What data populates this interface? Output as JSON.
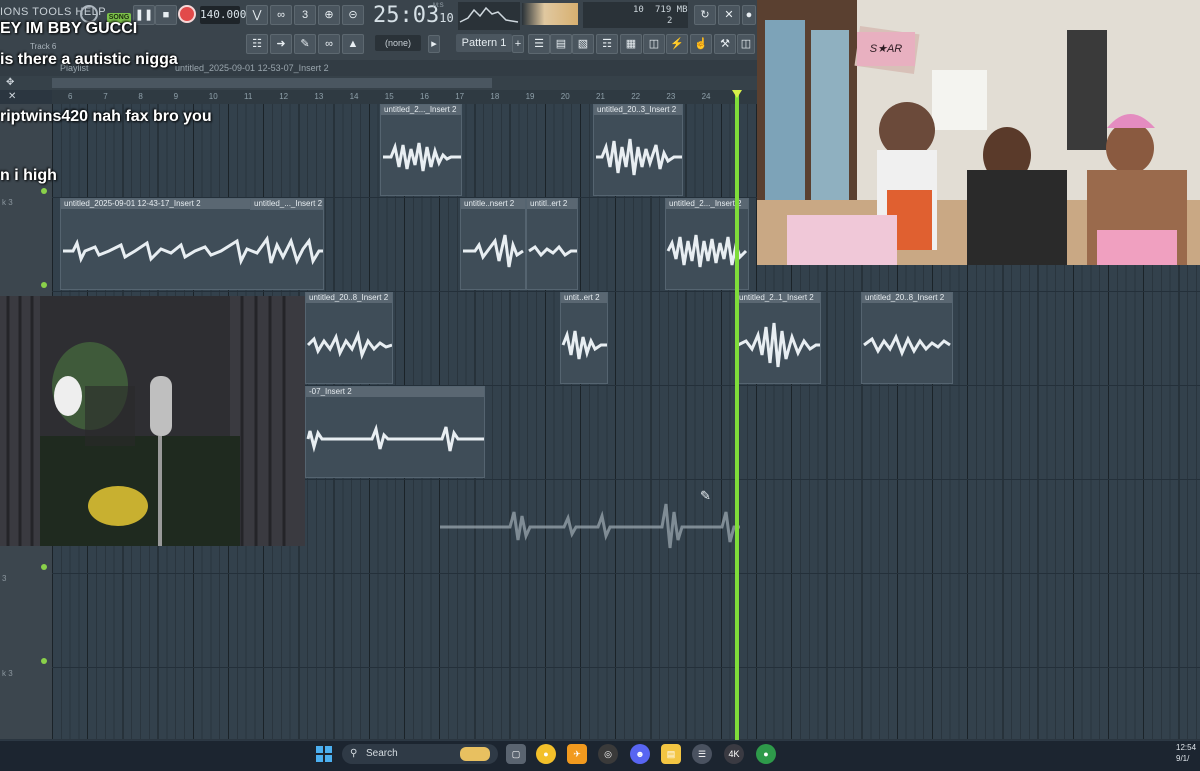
{
  "app": {
    "menu": "IONS TOOLS HELP",
    "song_badge": "SONG",
    "bpm": "140.000",
    "time_main": "25:03",
    "time_sub": "10",
    "time_unit": "M:S",
    "memory": "719 MB",
    "memory_top": "10",
    "memory_bottom": "2",
    "snap": "(none)",
    "pattern": "Pattern 1",
    "track_label": "Track 6"
  },
  "playlist": {
    "title": "Playlist",
    "breadcrumb": "untitled_2025-09-01 12-53-07_Insert 2",
    "ruler": [
      "6",
      "7",
      "8",
      "9",
      "10",
      "11",
      "12",
      "13",
      "14",
      "15",
      "16",
      "17",
      "18",
      "19",
      "20",
      "21",
      "22",
      "23",
      "24"
    ],
    "track_labels": [
      "k 3",
      "3",
      "k 3"
    ],
    "clips": [
      {
        "label": "untitled_2..._Insert 2"
      },
      {
        "label": "untitled_20..3_Insert 2"
      },
      {
        "label": "untitled_2025-09-01 12-43-17_Insert 2"
      },
      {
        "label": "untitled_..._Insert 2"
      },
      {
        "label": "untitle..nsert 2"
      },
      {
        "label": "untitl..ert 2"
      },
      {
        "label": "untitled_2..._Insert 2"
      },
      {
        "label": "untitled_20..8_Insert 2"
      },
      {
        "label": "untit..ert 2"
      },
      {
        "label": "untitled_2..1_Insert 2"
      },
      {
        "label": "untitled_20..8_Insert 2"
      },
      {
        "label": "-07_Insert 2"
      }
    ]
  },
  "chat": {
    "line1": "EY IM BBY GUCCI",
    "line2": "is there a autistic nigga",
    "line3": "riptwins420 nah fax bro you",
    "line4": "n i high"
  },
  "cam_right": {
    "banner": "S★AR"
  },
  "taskbar": {
    "search_placeholder": "Search",
    "badge_4k": "4K",
    "clock_time": "12:54",
    "clock_date": "9/1/"
  }
}
